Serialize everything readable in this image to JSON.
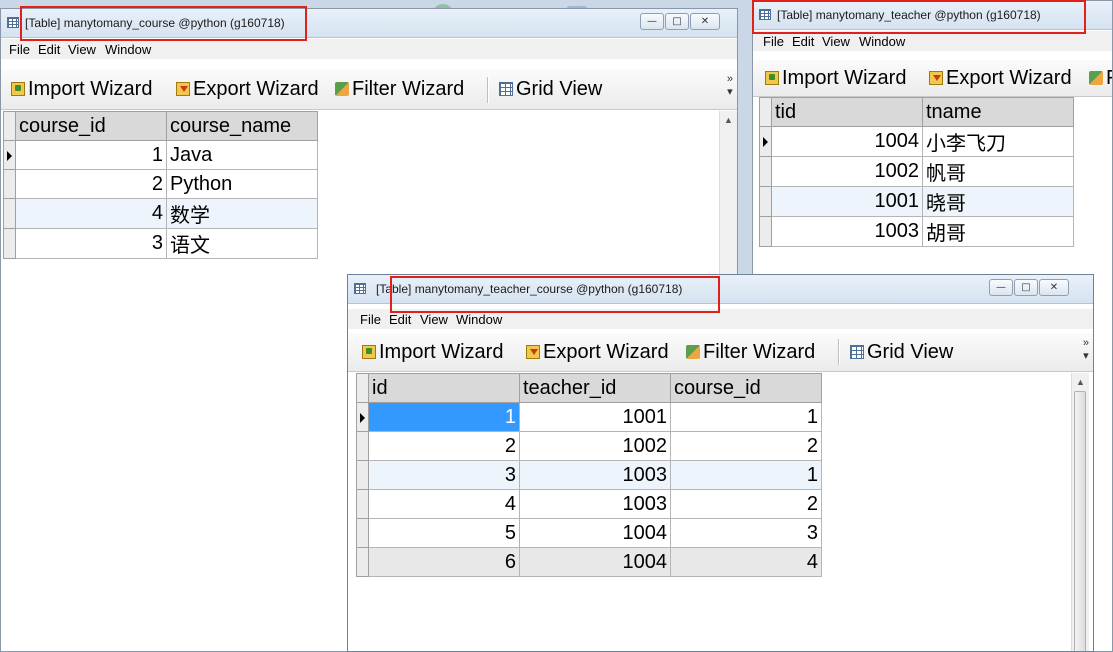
{
  "menu": [
    "File",
    "Edit",
    "View",
    "Window"
  ],
  "toolbar": {
    "import": "Import Wizard",
    "export": "Export Wizard",
    "filter": "Filter Wizard",
    "grid": "Grid View",
    "filter_clipped": "F"
  },
  "windows": {
    "course": {
      "title": "[Table] manytomany_course @python (g160718)",
      "columns": [
        "course_id",
        "course_name"
      ],
      "rows": [
        [
          "1",
          "Java"
        ],
        [
          "2",
          "Python"
        ],
        [
          "4",
          "数学"
        ],
        [
          "3",
          "语文"
        ]
      ]
    },
    "teacher": {
      "title": "[Table] manytomany_teacher @python (g160718)",
      "columns": [
        "tid",
        "tname"
      ],
      "rows": [
        [
          "1004",
          "小李飞刀"
        ],
        [
          "1002",
          "帆哥"
        ],
        [
          "1001",
          "晓哥"
        ],
        [
          "1003",
          "胡哥"
        ]
      ]
    },
    "teacher_course": {
      "title": "[Table] manytomany_teacher_course @python (g160718)",
      "columns": [
        "id",
        "teacher_id",
        "course_id"
      ],
      "rows": [
        [
          "1",
          "1001",
          "1"
        ],
        [
          "2",
          "1002",
          "2"
        ],
        [
          "3",
          "1003",
          "1"
        ],
        [
          "4",
          "1003",
          "2"
        ],
        [
          "5",
          "1004",
          "3"
        ],
        [
          "6",
          "1004",
          "4"
        ]
      ]
    }
  },
  "colors": {
    "highlight": "#e0201a",
    "selection": "#3399ff"
  }
}
